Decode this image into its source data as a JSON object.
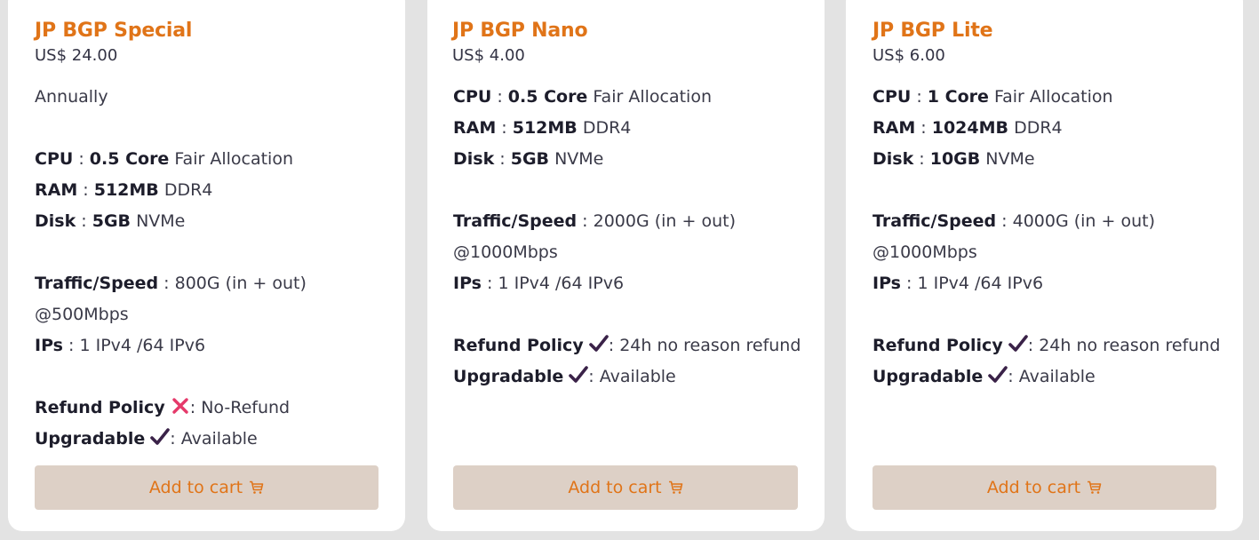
{
  "colors": {
    "accent": "#e07418",
    "button_bg": "#ddd0c6",
    "check": "#3a2248",
    "cross": "#e5396a"
  },
  "plans": [
    {
      "name": "JP BGP Special",
      "price": "US$ 24.00",
      "billing": "Annually",
      "cpu_label": "CPU",
      "cpu_value": "0.5 Core",
      "cpu_note": "Fair Allocation",
      "ram_label": "RAM",
      "ram_value": "512MB",
      "ram_note": "DDR4",
      "disk_label": "Disk",
      "disk_value": "5GB",
      "disk_note": "NVMe",
      "traffic_label": "Traffic/Speed",
      "traffic_value": ": 800G (in + out)",
      "speed": "@500Mbps",
      "ips_label": "IPs",
      "ips_value": ": 1 IPv4 /64 IPv6",
      "refund_label": "Refund Policy",
      "refund_icon": "cross-icon",
      "refund_value": ": No-Refund",
      "upgrade_label": "Upgradable",
      "upgrade_icon": "check-icon",
      "upgrade_value": ": Available",
      "button_label": "Add to cart"
    },
    {
      "name": "JP BGP Nano",
      "price": "US$ 4.00",
      "cpu_label": "CPU",
      "cpu_value": "0.5 Core",
      "cpu_note": "Fair Allocation",
      "ram_label": "RAM",
      "ram_value": "512MB",
      "ram_note": "DDR4",
      "disk_label": "Disk",
      "disk_value": "5GB",
      "disk_note": "NVMe",
      "traffic_label": "Traffic/Speed",
      "traffic_value": ": 2000G (in + out)",
      "speed": "@1000Mbps",
      "ips_label": "IPs",
      "ips_value": ": 1 IPv4 /64 IPv6",
      "refund_label": "Refund Policy",
      "refund_icon": "check-icon",
      "refund_value": ": 24h no reason refund",
      "upgrade_label": "Upgradable",
      "upgrade_icon": "check-icon",
      "upgrade_value": ": Available",
      "button_label": "Add to cart"
    },
    {
      "name": "JP BGP Lite",
      "price": "US$ 6.00",
      "cpu_label": "CPU",
      "cpu_value": "1 Core",
      "cpu_note": "Fair Allocation",
      "ram_label": "RAM",
      "ram_value": "1024MB",
      "ram_note": "DDR4",
      "disk_label": "Disk",
      "disk_value": "10GB",
      "disk_note": "NVMe",
      "traffic_label": "Traffic/Speed",
      "traffic_value": ": 4000G (in + out)",
      "speed": "@1000Mbps",
      "ips_label": "IPs",
      "ips_value": ": 1 IPv4 /64 IPv6",
      "refund_label": "Refund Policy",
      "refund_icon": "check-icon",
      "refund_value": ": 24h no reason refund",
      "upgrade_label": "Upgradable",
      "upgrade_icon": "check-icon",
      "upgrade_value": ": Available",
      "button_label": "Add to cart"
    }
  ]
}
